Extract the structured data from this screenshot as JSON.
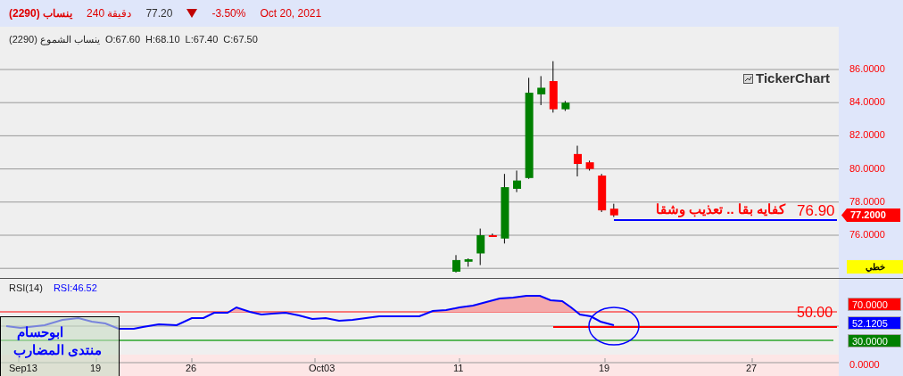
{
  "header": {
    "symbol": "ينساب (2290)",
    "interval": "240 دقيقة",
    "price": "77.20",
    "change": "-3.50%",
    "date": "Oct 20, 2021"
  },
  "price_panel": {
    "title": "ينساب الشموع (2290)",
    "ohlc": [
      "O:67.60",
      "H:68.10",
      "L:67.40",
      "C:67.50"
    ],
    "logo": "TickerChart",
    "axis_labels": [
      "86.0000",
      "84.0000",
      "82.0000",
      "80.0000",
      "78.0000",
      "76.0000"
    ],
    "note": "كفايه بقا .. تعذيب وشقا",
    "level_label": "76.90",
    "last_price_tag": "77.2000",
    "chart_type_button": "خطي"
  },
  "rsi_panel": {
    "indicator": "RSI(14)",
    "reading": "RSI:46.52",
    "level_label": "50.00",
    "axis_tags": [
      {
        "text": "70.0000",
        "color": "#ff0000"
      },
      {
        "text": "52.1205",
        "color": "#0000ff"
      },
      {
        "text": "30.0000",
        "color": "#008000"
      }
    ],
    "zero_label": "0.0000",
    "note_box": [
      "ابوحسام",
      "منتدى المضارب"
    ],
    "x_labels": [
      "Sep13",
      "19",
      "26",
      "Oct03",
      "11",
      "19",
      "27"
    ]
  }
}
